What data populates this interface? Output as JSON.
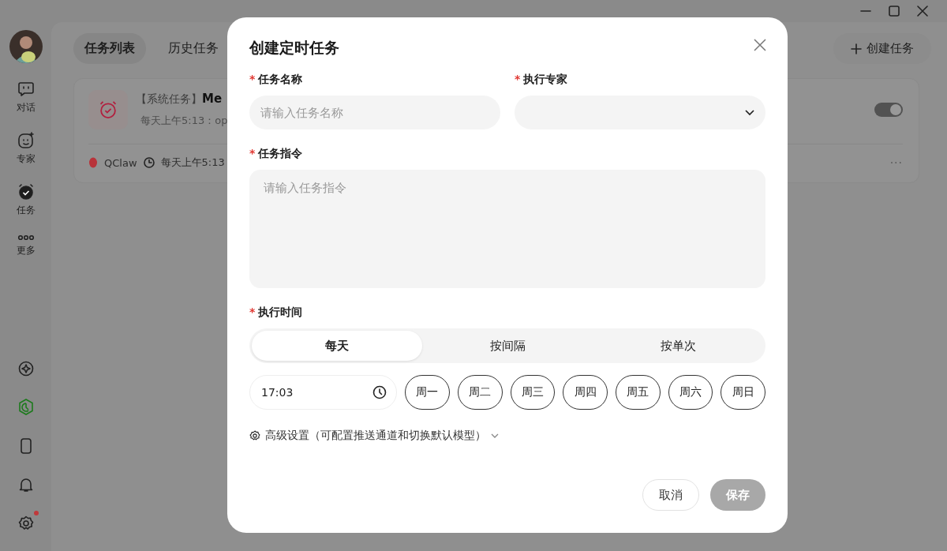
{
  "sidebar": {
    "nav": [
      {
        "kind": "chat",
        "label": "对话",
        "selected": false
      },
      {
        "kind": "expert",
        "label": "专家",
        "selected": false
      },
      {
        "kind": "task",
        "label": "任务",
        "selected": true
      },
      {
        "kind": "more",
        "label": "更多",
        "selected": false
      }
    ],
    "tools": [
      {
        "kind": "compass"
      },
      {
        "kind": "hexagon"
      },
      {
        "kind": "phone"
      },
      {
        "kind": "bell"
      },
      {
        "kind": "settings",
        "badge": true
      }
    ]
  },
  "tabs": [
    {
      "label": "任务列表",
      "selected": true
    },
    {
      "label": "历史任务",
      "selected": false
    }
  ],
  "create_button": "创建任务",
  "task_card": {
    "tag": "【系统任务】",
    "title": "Me",
    "schedule": "每天上午5:13：op",
    "on": true,
    "agent": "QClaw",
    "time": "每天上午5:13",
    "more": "···"
  },
  "dialog": {
    "title": "创建定时任务",
    "name_field": {
      "label": "任务名称",
      "required_mark": "*",
      "placeholder": "请输入任务名称"
    },
    "expert_field": {
      "label": "执行专家",
      "required_mark": "*"
    },
    "instruction_field": {
      "label": "任务指令",
      "required_mark": "*",
      "placeholder": "请输入任务指令"
    },
    "time_section": {
      "label": "执行时间",
      "required_mark": "*",
      "modes": [
        {
          "label": "每天",
          "selected": true
        },
        {
          "label": "按间隔",
          "selected": false
        },
        {
          "label": "按单次",
          "selected": false
        }
      ],
      "time": "17:03",
      "days": [
        {
          "label": "周一",
          "selected": true
        },
        {
          "label": "周二",
          "selected": true
        },
        {
          "label": "周三",
          "selected": true
        },
        {
          "label": "周四",
          "selected": true
        },
        {
          "label": "周五",
          "selected": true
        },
        {
          "label": "周六",
          "selected": true
        },
        {
          "label": "周日",
          "selected": true
        }
      ]
    },
    "advanced": "高级设置（可配置推送通道和切换默认模型）",
    "cancel": "取消",
    "save": "保存",
    "save_disabled": true
  }
}
